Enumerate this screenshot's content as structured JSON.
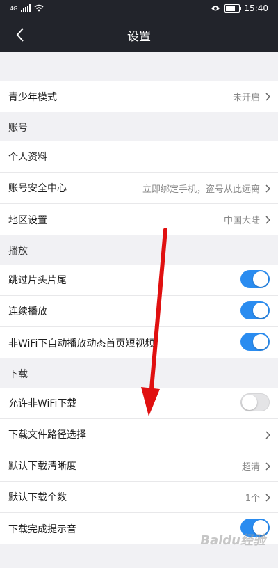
{
  "status_bar": {
    "network": "4G",
    "time": "15:40",
    "battery_level": 0.7
  },
  "header": {
    "title": "设置"
  },
  "youth": {
    "label": "青少年模式",
    "value": "未开启"
  },
  "account": {
    "header": "账号",
    "items": [
      {
        "label": "个人资料",
        "value": ""
      },
      {
        "label": "账号安全中心",
        "value": "立即绑定手机，盗号从此远离"
      },
      {
        "label": "地区设置",
        "value": "中国大陆"
      }
    ]
  },
  "playback": {
    "header": "播放",
    "items": [
      {
        "label": "跳过片头片尾",
        "on": true
      },
      {
        "label": "连续播放",
        "on": true
      },
      {
        "label": "非WiFi下自动播放动态首页短视频",
        "on": true
      }
    ]
  },
  "download": {
    "header": "下载",
    "allow_non_wifi": {
      "label": "允许非WiFi下载",
      "on": false
    },
    "path": {
      "label": "下载文件路径选择"
    },
    "quality": {
      "label": "默认下载清晰度",
      "value": "超清"
    },
    "count": {
      "label": "默认下载个数",
      "value": "1个"
    },
    "complete_sound": {
      "label": "下载完成提示音",
      "on": true
    }
  },
  "watermark": "Baidu经验",
  "colors": {
    "toggle_on": "#2a8cf0",
    "toggle_off": "#e4e4e6",
    "annotation_arrow": "#e01010",
    "header_bg": "#22242b"
  }
}
